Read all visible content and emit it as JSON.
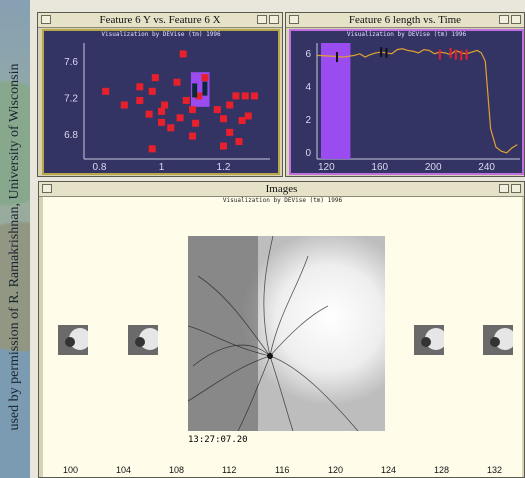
{
  "credit": "used by permission of R. Ramakrishnan, University of Wisconsin",
  "window_scatter": {
    "title": "Feature 6 Y vs. Feature 6 X",
    "caption": "Visualization by DEVise (tm) 1996"
  },
  "window_line": {
    "title": "Feature 6 length vs. Time",
    "caption": "Visualization by DEVise (tm) 1996"
  },
  "window_images": {
    "title": "Images",
    "caption": "Visualization by DEVise (tm) 1996",
    "timestamp": "13:27:07.20",
    "axis_ticks": [
      "100",
      "104",
      "108",
      "112",
      "116",
      "120",
      "124",
      "128",
      "132"
    ]
  },
  "colors": {
    "plot_bg": "#343464",
    "marker": "#e8202c",
    "highlight": "#9a4cf0",
    "line": "#e0a030",
    "image_bg": "#fffcea"
  },
  "chart_data": [
    {
      "type": "scatter",
      "title": "Feature 6 Y vs. Feature 6 X",
      "x_ticks": [
        "0.8",
        "1",
        "1.2"
      ],
      "y_ticks": [
        "6.8",
        "7.2",
        "7.6"
      ],
      "xlim": [
        0.75,
        1.35
      ],
      "ylim": [
        6.55,
        7.8
      ],
      "points": [
        [
          0.82,
          7.27
        ],
        [
          0.88,
          7.12
        ],
        [
          0.93,
          7.32
        ],
        [
          0.93,
          7.17
        ],
        [
          0.96,
          7.02
        ],
        [
          0.97,
          7.27
        ],
        [
          0.98,
          7.42
        ],
        [
          1.0,
          7.05
        ],
        [
          1.0,
          6.93
        ],
        [
          1.01,
          7.12
        ],
        [
          1.03,
          6.87
        ],
        [
          1.05,
          7.37
        ],
        [
          1.07,
          7.68
        ],
        [
          1.08,
          7.17
        ],
        [
          1.06,
          6.98
        ],
        [
          1.1,
          7.07
        ],
        [
          1.11,
          6.92
        ],
        [
          1.1,
          6.78
        ],
        [
          1.12,
          7.22
        ],
        [
          1.14,
          7.42
        ],
        [
          1.18,
          7.07
        ],
        [
          1.2,
          6.97
        ],
        [
          1.2,
          6.67
        ],
        [
          1.22,
          6.82
        ],
        [
          1.22,
          7.12
        ],
        [
          1.24,
          7.22
        ],
        [
          1.25,
          6.72
        ],
        [
          1.26,
          6.95
        ],
        [
          1.27,
          7.22
        ],
        [
          1.28,
          7.0
        ],
        [
          1.3,
          7.22
        ],
        [
          0.97,
          6.64
        ]
      ],
      "highlight": {
        "x0": 1.095,
        "x1": 1.155,
        "y0": 7.1,
        "y1": 7.48
      },
      "dark_marks": [
        [
          1.107,
          7.28
        ],
        [
          1.14,
          7.3
        ]
      ]
    },
    {
      "type": "line",
      "title": "Feature 6 length vs. Time",
      "x_ticks": [
        "120",
        "160",
        "200",
        "240"
      ],
      "y_ticks": [
        "0",
        "2",
        "4",
        "6"
      ],
      "xlim": [
        113,
        265
      ],
      "ylim": [
        -0.3,
        6.6
      ],
      "series": [
        {
          "x": [
            113,
            125,
            133,
            141,
            145,
            149,
            153,
            157,
            161,
            165,
            169,
            173,
            177,
            181,
            185,
            189,
            193,
            197,
            201,
            205,
            209,
            213,
            217,
            221,
            225,
            229,
            233,
            236,
            239,
            243,
            247,
            251,
            255,
            259,
            263
          ],
          "y": [
            5.85,
            5.8,
            5.75,
            5.85,
            5.95,
            5.75,
            5.9,
            6.0,
            6.05,
            6.0,
            5.95,
            6.2,
            6.25,
            6.15,
            6.1,
            6.0,
            6.2,
            6.15,
            5.95,
            6.05,
            6.0,
            5.9,
            6.15,
            6.0,
            5.95,
            6.05,
            6.15,
            6.0,
            5.5,
            1.4,
            0.3,
            0.05,
            -0.05,
            0.25,
            0.45
          ]
        }
      ],
      "highlight": {
        "x0": 116,
        "x1": 138
      },
      "black_marks": [
        [
          128,
          5.75
        ],
        [
          161,
          6.05
        ],
        [
          165,
          6.0
        ]
      ],
      "red_marks": [
        [
          205,
          5.9
        ],
        [
          213,
          6.0
        ],
        [
          217,
          5.9
        ],
        [
          221,
          5.85
        ],
        [
          225,
          5.9
        ]
      ]
    }
  ]
}
